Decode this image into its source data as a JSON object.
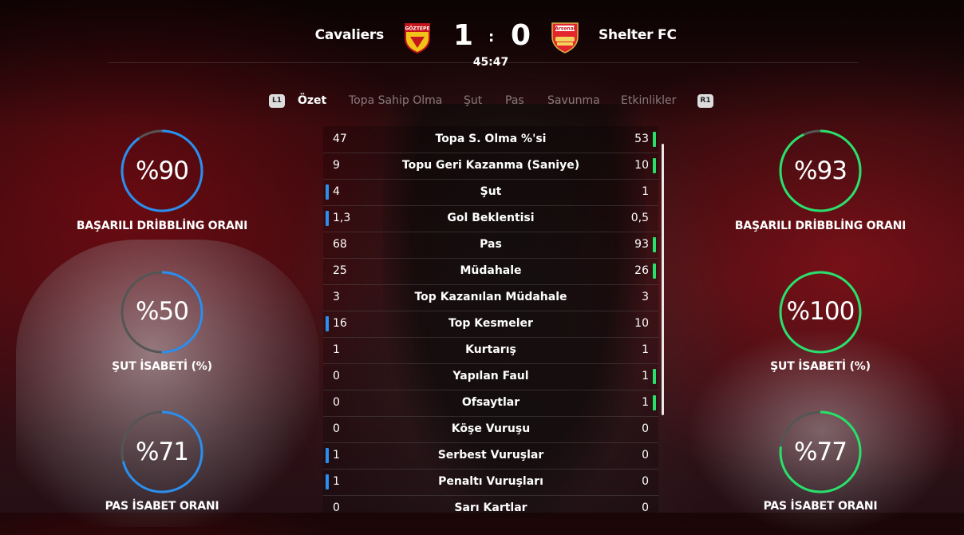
{
  "match": {
    "home_team": "Cavaliers",
    "away_team": "Shelter FC",
    "home_score": "1",
    "separator": ":",
    "away_score": "0",
    "clock": "45:47",
    "home_crest_text": "GÖZTEPE",
    "away_crest_text": "Arsenal"
  },
  "tabs": {
    "left_button": "L1",
    "right_button": "R1",
    "items": [
      {
        "label": "Özet",
        "active": true
      },
      {
        "label": "Topa Sahip Olma",
        "active": false
      },
      {
        "label": "Şut",
        "active": false
      },
      {
        "label": "Pas",
        "active": false
      },
      {
        "label": "Savunma",
        "active": false
      },
      {
        "label": "Etkinlikler",
        "active": false
      }
    ]
  },
  "home_rings": [
    {
      "value": "%90",
      "label": "BAŞARILI DRİBBLİNG ORANI",
      "fraction": 0.9
    },
    {
      "value": "%50",
      "label": "ŞUT İSABETİ (%)",
      "fraction": 0.5
    },
    {
      "value": "%71",
      "label": "PAS İSABET ORANI",
      "fraction": 0.71
    }
  ],
  "away_rings": [
    {
      "value": "%93",
      "label": "BAŞARILI DRİBBLİNG ORANI",
      "fraction": 0.93
    },
    {
      "value": "%100",
      "label": "ŞUT İSABETİ (%)",
      "fraction": 1.0
    },
    {
      "value": "%77",
      "label": "PAS İSABET ORANI",
      "fraction": 0.77
    }
  ],
  "stats": [
    {
      "name": "Topa S. Olma %'si",
      "home": "47",
      "away": "53",
      "leader": "away"
    },
    {
      "name": "Topu Geri Kazanma (Saniye)",
      "home": "9",
      "away": "10",
      "leader": "away"
    },
    {
      "name": "Şut",
      "home": "4",
      "away": "1",
      "leader": "home"
    },
    {
      "name": "Gol Beklentisi",
      "home": "1,3",
      "away": "0,5",
      "leader": "home"
    },
    {
      "name": "Pas",
      "home": "68",
      "away": "93",
      "leader": "away"
    },
    {
      "name": "Müdahale",
      "home": "25",
      "away": "26",
      "leader": "away"
    },
    {
      "name": "Top Kazanılan Müdahale",
      "home": "3",
      "away": "3",
      "leader": "none"
    },
    {
      "name": "Top Kesmeler",
      "home": "16",
      "away": "10",
      "leader": "home"
    },
    {
      "name": "Kurtarış",
      "home": "1",
      "away": "1",
      "leader": "none"
    },
    {
      "name": "Yapılan Faul",
      "home": "0",
      "away": "1",
      "leader": "away"
    },
    {
      "name": "Ofsaytlar",
      "home": "0",
      "away": "1",
      "leader": "away"
    },
    {
      "name": "Köşe Vuruşu",
      "home": "0",
      "away": "0",
      "leader": "none"
    },
    {
      "name": "Serbest Vuruşlar",
      "home": "1",
      "away": "0",
      "leader": "home"
    },
    {
      "name": "Penaltı Vuruşları",
      "home": "1",
      "away": "0",
      "leader": "home"
    },
    {
      "name": "Sarı Kartlar",
      "home": "0",
      "away": "0",
      "leader": "none"
    }
  ],
  "colors": {
    "home_accent": "#2a8ff0",
    "away_accent": "#29e06a",
    "ring_track": "#555555"
  }
}
